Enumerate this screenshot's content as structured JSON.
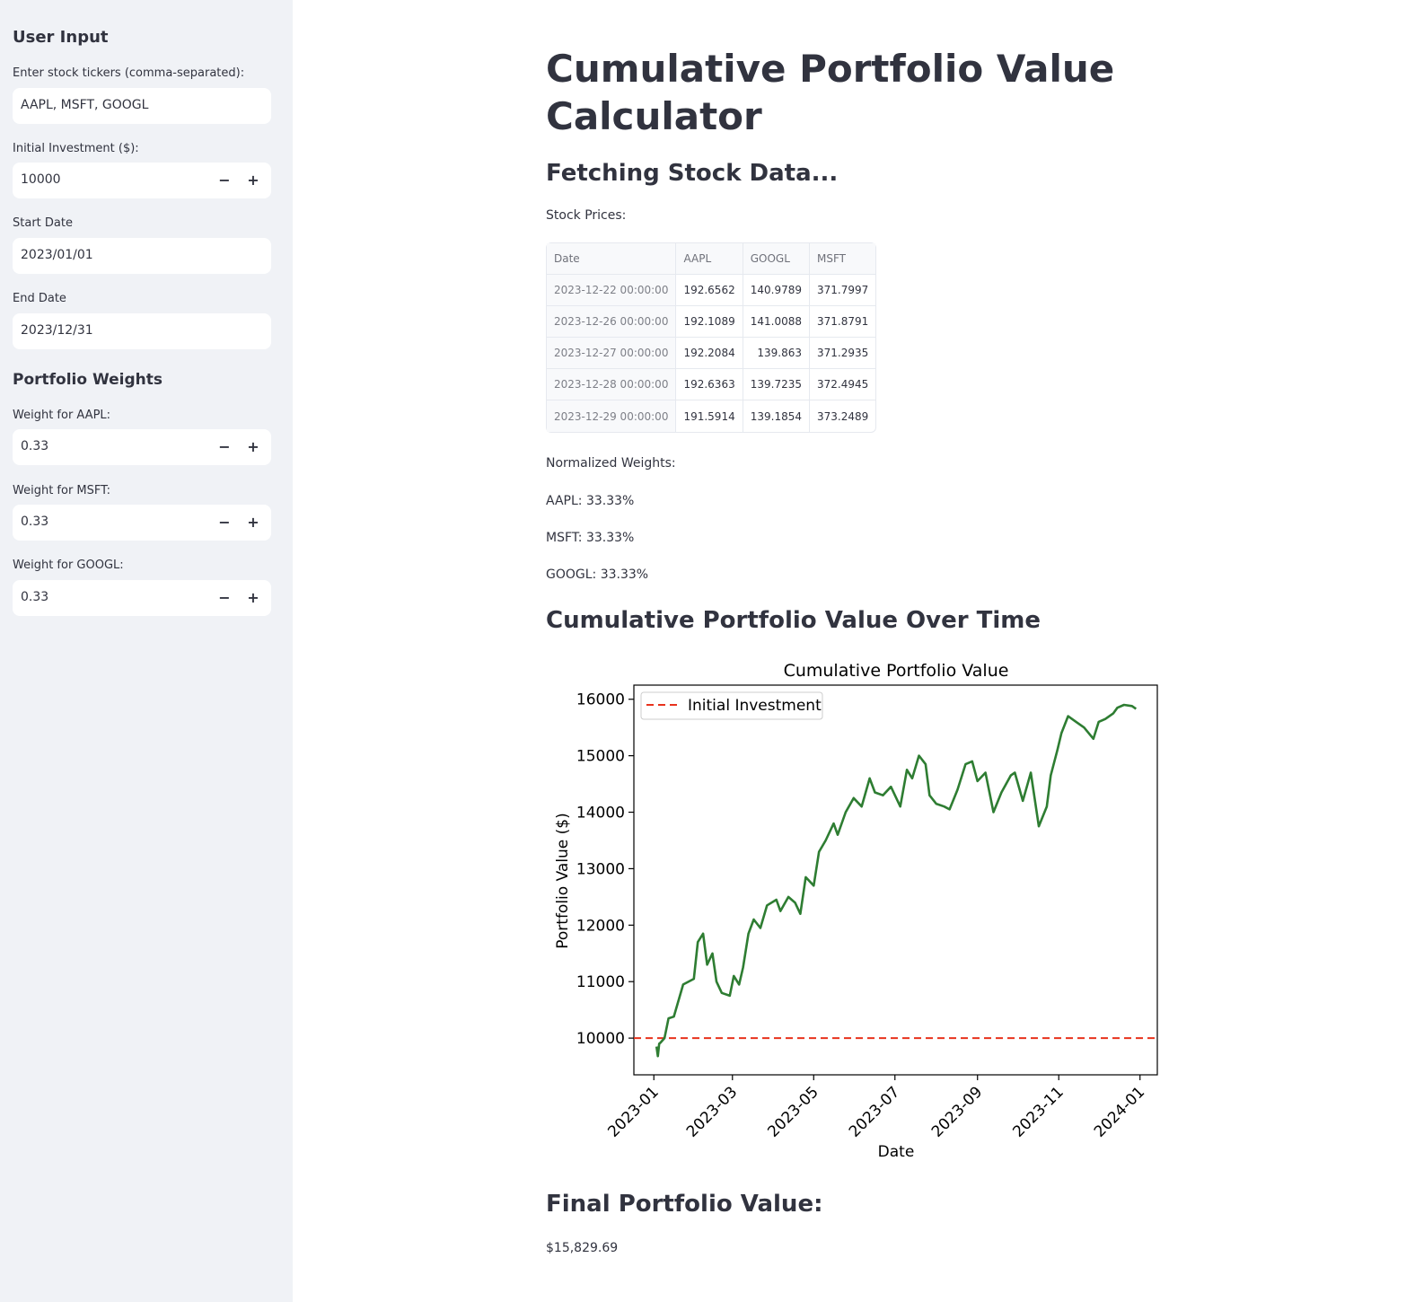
{
  "sidebar": {
    "user_input_heading": "User Input",
    "tickers": {
      "label": "Enter stock tickers (comma-separated):",
      "value": "AAPL, MSFT, GOOGL"
    },
    "investment": {
      "label": "Initial Investment ($):",
      "value": "10000"
    },
    "start_date": {
      "label": "Start Date",
      "value": "2023/01/01"
    },
    "end_date": {
      "label": "End Date",
      "value": "2023/12/31"
    },
    "weights_heading": "Portfolio Weights",
    "weights": [
      {
        "label": "Weight for AAPL:",
        "value": "0.33"
      },
      {
        "label": "Weight for MSFT:",
        "value": "0.33"
      },
      {
        "label": "Weight for GOOGL:",
        "value": "0.33"
      }
    ],
    "stepper_minus": "−",
    "stepper_plus": "+"
  },
  "main": {
    "title": "Cumulative Portfolio Value Calculator",
    "fetching_heading": "Fetching Stock Data...",
    "stock_prices_label": "Stock Prices:",
    "table": {
      "columns": [
        "Date",
        "AAPL",
        "GOOGL",
        "MSFT"
      ],
      "rows": [
        [
          "2023-12-22 00:00:00",
          "192.6562",
          "140.9789",
          "371.7997"
        ],
        [
          "2023-12-26 00:00:00",
          "192.1089",
          "141.0088",
          "371.8791"
        ],
        [
          "2023-12-27 00:00:00",
          "192.2084",
          "139.863",
          "371.2935"
        ],
        [
          "2023-12-28 00:00:00",
          "192.6363",
          "139.7235",
          "372.4945"
        ],
        [
          "2023-12-29 00:00:00",
          "191.5914",
          "139.1854",
          "373.2489"
        ]
      ]
    },
    "normalized_label": "Normalized Weights:",
    "normalized": [
      "AAPL: 33.33%",
      "MSFT: 33.33%",
      "GOOGL: 33.33%"
    ],
    "chart_heading": "Cumulative Portfolio Value Over Time",
    "final_heading": "Final Portfolio Value:",
    "final_value": "$15,829.69"
  },
  "chart_data": {
    "type": "line",
    "title": "Cumulative Portfolio Value",
    "xlabel": "Date",
    "ylabel": "Portfolio Value ($)",
    "ylim": [
      9350,
      16250
    ],
    "xlim": [
      "2022-12-17",
      "2024-01-14"
    ],
    "yticks": [
      10000,
      11000,
      12000,
      13000,
      14000,
      15000,
      16000
    ],
    "xticks": [
      "2023-01",
      "2023-03",
      "2023-05",
      "2023-07",
      "2023-09",
      "2023-11",
      "2024-01"
    ],
    "legend": {
      "label": "Initial Investment",
      "location": "upper left"
    },
    "hline": {
      "value": 10000,
      "color": "#e8331d",
      "label": "Initial Investment"
    },
    "line_color": "#2e7d32",
    "series": [
      {
        "x": [
          "2023-01-03",
          "2023-01-04",
          "2023-01-05",
          "2023-01-06",
          "2023-01-09",
          "2023-01-12",
          "2023-01-16",
          "2023-01-23",
          "2023-01-31",
          "2023-02-03",
          "2023-02-07",
          "2023-02-10",
          "2023-02-14",
          "2023-02-17",
          "2023-02-21",
          "2023-02-27",
          "2023-03-02",
          "2023-03-06",
          "2023-03-09",
          "2023-03-13",
          "2023-03-17",
          "2023-03-22",
          "2023-03-27",
          "2023-04-03",
          "2023-04-06",
          "2023-04-12",
          "2023-04-17",
          "2023-04-21",
          "2023-04-25",
          "2023-05-01",
          "2023-05-05",
          "2023-05-10",
          "2023-05-16",
          "2023-05-19",
          "2023-05-25",
          "2023-05-31",
          "2023-06-06",
          "2023-06-12",
          "2023-06-16",
          "2023-06-22",
          "2023-06-28",
          "2023-07-05",
          "2023-07-10",
          "2023-07-14",
          "2023-07-19",
          "2023-07-24",
          "2023-07-27",
          "2023-08-01",
          "2023-08-07",
          "2023-08-11",
          "2023-08-17",
          "2023-08-23",
          "2023-08-28",
          "2023-09-01",
          "2023-09-07",
          "2023-09-13",
          "2023-09-19",
          "2023-09-26",
          "2023-09-29",
          "2023-10-05",
          "2023-10-11",
          "2023-10-17",
          "2023-10-23",
          "2023-10-26",
          "2023-10-31",
          "2023-11-03",
          "2023-11-08",
          "2023-11-14",
          "2023-11-20",
          "2023-11-27",
          "2023-12-01",
          "2023-12-06",
          "2023-12-12",
          "2023-12-15",
          "2023-12-20",
          "2023-12-26",
          "2023-12-29"
        ],
        "y": [
          9850,
          9680,
          9900,
          9920,
          10000,
          10350,
          10380,
          10950,
          11050,
          11700,
          11850,
          11300,
          11500,
          11000,
          10800,
          10750,
          11100,
          10950,
          11250,
          11850,
          12100,
          11950,
          12350,
          12450,
          12250,
          12500,
          12400,
          12200,
          12850,
          12700,
          13300,
          13500,
          13800,
          13600,
          14000,
          14250,
          14100,
          14600,
          14350,
          14300,
          14450,
          14100,
          14750,
          14600,
          15000,
          14850,
          14300,
          14150,
          14100,
          14050,
          14400,
          14850,
          14900,
          14550,
          14700,
          14000,
          14350,
          14650,
          14700,
          14200,
          14700,
          13750,
          14100,
          14650,
          15100,
          15400,
          15700,
          15600,
          15500,
          15300,
          15600,
          15650,
          15750,
          15850,
          15900,
          15880,
          15830
        ]
      }
    ]
  }
}
